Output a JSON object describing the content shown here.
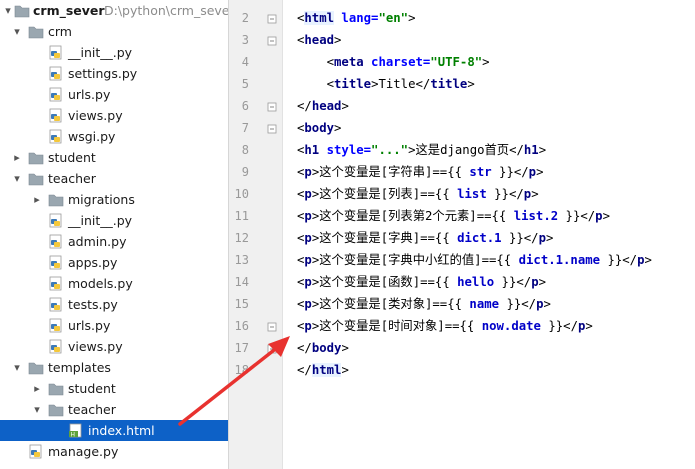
{
  "project": {
    "name": "crm_sever",
    "path": "D:\\python\\crm_sever"
  },
  "tree": [
    {
      "label": "crm",
      "type": "folder",
      "depth": 1,
      "open": true
    },
    {
      "label": "__init__.py",
      "type": "py",
      "depth": 2
    },
    {
      "label": "settings.py",
      "type": "py",
      "depth": 2
    },
    {
      "label": "urls.py",
      "type": "py",
      "depth": 2
    },
    {
      "label": "views.py",
      "type": "py",
      "depth": 2
    },
    {
      "label": "wsgi.py",
      "type": "py",
      "depth": 2
    },
    {
      "label": "student",
      "type": "folder",
      "depth": 1,
      "open": false
    },
    {
      "label": "teacher",
      "type": "folder",
      "depth": 1,
      "open": true
    },
    {
      "label": "migrations",
      "type": "folder",
      "depth": 2,
      "open": false
    },
    {
      "label": "__init__.py",
      "type": "py",
      "depth": 2
    },
    {
      "label": "admin.py",
      "type": "py",
      "depth": 2
    },
    {
      "label": "apps.py",
      "type": "py",
      "depth": 2
    },
    {
      "label": "models.py",
      "type": "py",
      "depth": 2
    },
    {
      "label": "tests.py",
      "type": "py",
      "depth": 2
    },
    {
      "label": "urls.py",
      "type": "py",
      "depth": 2
    },
    {
      "label": "views.py",
      "type": "py",
      "depth": 2
    },
    {
      "label": "templates",
      "type": "folder",
      "depth": 1,
      "open": true
    },
    {
      "label": "student",
      "type": "folder",
      "depth": 2,
      "open": false
    },
    {
      "label": "teacher",
      "type": "folder",
      "depth": 2,
      "open": true
    },
    {
      "label": "index.html",
      "type": "html",
      "depth": 3,
      "selected": true
    },
    {
      "label": "manage.py",
      "type": "py",
      "depth": 1
    }
  ],
  "line_numbers": [
    "2",
    "3",
    "4",
    "5",
    "6",
    "7",
    "8",
    "9",
    "10",
    "11",
    "12",
    "13",
    "14",
    "15",
    "16",
    "17",
    "18"
  ],
  "code_lines": [
    [
      [
        "br",
        "<"
      ],
      [
        "tag",
        "html"
      ],
      [
        "attr",
        " lang="
      ],
      [
        "str",
        "\"en\""
      ],
      [
        "br",
        ">"
      ]
    ],
    [
      [
        "br",
        "<"
      ],
      [
        "tag",
        "head"
      ],
      [
        "br",
        ">"
      ]
    ],
    [
      [
        "",
        "    "
      ],
      [
        "br",
        "<"
      ],
      [
        "tag",
        "meta"
      ],
      [
        "attr",
        " charset="
      ],
      [
        "str",
        "\"UTF-8\""
      ],
      [
        "br",
        ">"
      ]
    ],
    [
      [
        "",
        "    "
      ],
      [
        "br",
        "<"
      ],
      [
        "tag",
        "title"
      ],
      [
        "br",
        ">"
      ],
      [
        "",
        "Title"
      ],
      [
        "br",
        "</"
      ],
      [
        "tag",
        "title"
      ],
      [
        "br",
        ">"
      ]
    ],
    [
      [
        "br",
        "</"
      ],
      [
        "tag",
        "head"
      ],
      [
        "br",
        ">"
      ]
    ],
    [
      [
        "br",
        "<"
      ],
      [
        "tag",
        "body"
      ],
      [
        "br",
        ">"
      ]
    ],
    [
      [
        "br",
        "<"
      ],
      [
        "tag",
        "h1"
      ],
      [
        "attr",
        " style="
      ],
      [
        "str",
        "\"...\""
      ],
      [
        "br",
        ">"
      ],
      [
        "",
        "这是django首页"
      ],
      [
        "br",
        "</"
      ],
      [
        "tag",
        "h1"
      ],
      [
        "br",
        ">"
      ]
    ],
    [
      [
        "br",
        "<"
      ],
      [
        "tag",
        "p"
      ],
      [
        "br",
        ">"
      ],
      [
        "",
        "这个变量是[字符串]=={{ "
      ],
      [
        "tpl",
        "str"
      ],
      [
        "",
        " }}"
      ],
      [
        "br",
        "</"
      ],
      [
        "tag",
        "p"
      ],
      [
        "br",
        ">"
      ]
    ],
    [
      [
        "br",
        "<"
      ],
      [
        "tag",
        "p"
      ],
      [
        "br",
        ">"
      ],
      [
        "",
        "这个变量是[列表]=={{ "
      ],
      [
        "tpl",
        "list"
      ],
      [
        "",
        " }}"
      ],
      [
        "br",
        "</"
      ],
      [
        "tag",
        "p"
      ],
      [
        "br",
        ">"
      ]
    ],
    [
      [
        "br",
        "<"
      ],
      [
        "tag",
        "p"
      ],
      [
        "br",
        ">"
      ],
      [
        "",
        "这个变量是[列表第2个元素]=={{ "
      ],
      [
        "tpl",
        "list.2"
      ],
      [
        "",
        " }}"
      ],
      [
        "br",
        "</"
      ],
      [
        "tag",
        "p"
      ],
      [
        "br",
        ">"
      ]
    ],
    [
      [
        "br",
        "<"
      ],
      [
        "tag",
        "p"
      ],
      [
        "br",
        ">"
      ],
      [
        "",
        "这个变量是[字典]=={{ "
      ],
      [
        "tpl",
        "dict.1"
      ],
      [
        "",
        " }}"
      ],
      [
        "br",
        "</"
      ],
      [
        "tag",
        "p"
      ],
      [
        "br",
        ">"
      ]
    ],
    [
      [
        "br",
        "<"
      ],
      [
        "tag",
        "p"
      ],
      [
        "br",
        ">"
      ],
      [
        "",
        "这个变量是[字典中小红的值]=={{ "
      ],
      [
        "tpl",
        "dict.1.name"
      ],
      [
        "",
        " }}"
      ],
      [
        "br",
        "</"
      ],
      [
        "tag",
        "p"
      ],
      [
        "br",
        ">"
      ]
    ],
    [
      [
        "br",
        "<"
      ],
      [
        "tag",
        "p"
      ],
      [
        "br",
        ">"
      ],
      [
        "",
        "这个变量是[函数]=={{ "
      ],
      [
        "tpl",
        "hello"
      ],
      [
        "",
        " }}"
      ],
      [
        "br",
        "</"
      ],
      [
        "tag",
        "p"
      ],
      [
        "br",
        ">"
      ]
    ],
    [
      [
        "br",
        "<"
      ],
      [
        "tag",
        "p"
      ],
      [
        "br",
        ">"
      ],
      [
        "",
        "这个变量是[类对象]=={{ "
      ],
      [
        "tpl",
        "name"
      ],
      [
        "",
        " }}"
      ],
      [
        "br",
        "</"
      ],
      [
        "tag",
        "p"
      ],
      [
        "br",
        ">"
      ]
    ],
    [
      [
        "br",
        "<"
      ],
      [
        "tag",
        "p"
      ],
      [
        "br",
        ">"
      ],
      [
        "",
        "这个变量是[时间对象]=={{ "
      ],
      [
        "tpl",
        "now.date"
      ],
      [
        "",
        " }}"
      ],
      [
        "br",
        "</"
      ],
      [
        "tag",
        "p"
      ],
      [
        "br",
        ">"
      ]
    ],
    [
      [
        "br",
        "</"
      ],
      [
        "tag",
        "body"
      ],
      [
        "br",
        ">"
      ]
    ],
    [
      [
        "br",
        "</"
      ],
      [
        "tag",
        "html"
      ],
      [
        "br",
        ">"
      ]
    ]
  ],
  "colors": {
    "selection": "#0d61c7",
    "arrow": "#e8322f",
    "tag": "#000080",
    "attr_value": "#008000"
  }
}
